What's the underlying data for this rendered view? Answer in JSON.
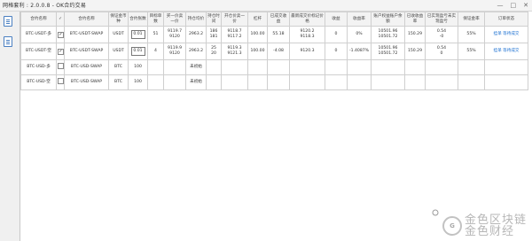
{
  "window": {
    "title": "网格套利 : 2.0.0.8 - OK合约交易",
    "controls": [
      "—",
      "□",
      "✕"
    ]
  },
  "columns": [
    "合约名称",
    "✓",
    "合约名称",
    "保证金币种",
    "合约张数",
    "目标单数",
    "买一价卖一价",
    "持仓均价",
    "持仓时间",
    "开仓价卖一价",
    "杠杆",
    "已成交收益",
    "最新成交价标记价格",
    "收益",
    "收益率",
    "账户权益账户余额",
    "已收收益率",
    "已实现盈亏未实现盈亏",
    "保证金率",
    "订单状态"
  ],
  "rows": [
    {
      "name": "BTC-USDT-多",
      "checked": true,
      "contract": "BTC-USDT-SWAP",
      "margin_ccy": "USDT",
      "qty": "0.01",
      "target": "51",
      "bid_ask": "9119.7\n9120",
      "avg_price": "2963.2",
      "hold_time": "186\n181",
      "open_price": "9118.7\n9117.2",
      "leverage": "100.00",
      "filled_profit": "55.18",
      "last_mark": "9120.2\n9118.3",
      "profit": "0",
      "profit_rate": "0%",
      "equity_balance": "10501.96\n10501.72",
      "earned_rate": "150.29",
      "realized_unrealized": "0.54\n-0",
      "margin_rate": "55%",
      "order_status": "挂单 等待成交"
    },
    {
      "name": "BTC-USDT-空",
      "checked": true,
      "contract": "BTC-USDT-SWAP",
      "margin_ccy": "USDT",
      "qty": "0.01",
      "target": "4",
      "bid_ask": "9119.9\n9120",
      "avg_price": "2963.2",
      "hold_time": "25\n20",
      "open_price": "9119.3\n9121.3",
      "leverage": "100.00",
      "filled_profit": "-4.08",
      "last_mark": "9120.3",
      "profit": "0",
      "profit_rate": "-1.4087%",
      "equity_balance": "10501.96\n10501.72",
      "earned_rate": "150.29",
      "realized_unrealized": "0.54\n0",
      "margin_rate": "55%",
      "order_status": "挂单 等待成交"
    },
    {
      "name": "BTC-USD-多",
      "checked": false,
      "contract": "BTC-USD-SWAP",
      "margin_ccy": "BTC",
      "qty": "100",
      "avg_price_status": "未初始"
    },
    {
      "name": "BTC-USD-空",
      "checked": false,
      "contract": "BTC-USD-SWAP",
      "margin_ccy": "BTC",
      "qty": "100",
      "avg_price_status": "未初始"
    }
  ],
  "watermark": {
    "line1": "金色区块链",
    "line2": "金色财经"
  }
}
